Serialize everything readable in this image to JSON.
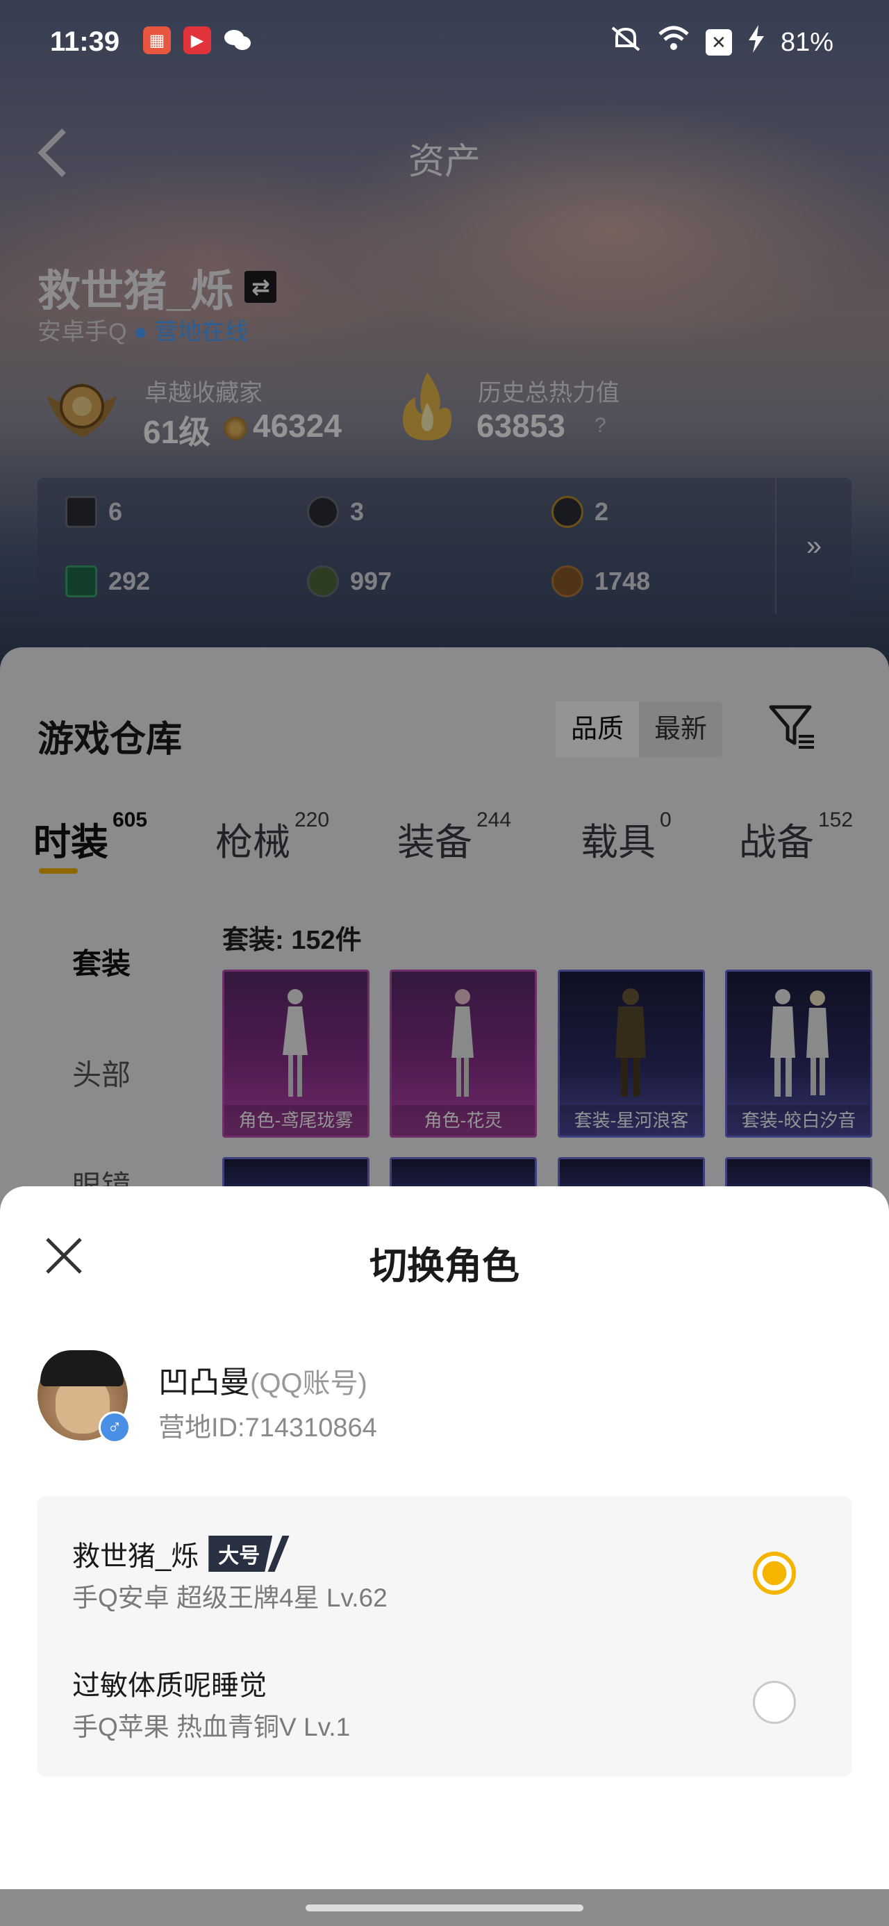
{
  "status_bar": {
    "time": "11:39",
    "battery": "81%",
    "icons": [
      "app-icon-1",
      "video-app-icon",
      "wechat-icon",
      "mute-icon",
      "wifi-icon",
      "x-box-icon",
      "charging-icon"
    ]
  },
  "header": {
    "title": "资产",
    "back_icon": "chevron-left-icon"
  },
  "profile": {
    "name": "救世猪_烁",
    "platform": "安卓手Q",
    "status": "营地在线",
    "rank_title": "卓越收藏家",
    "rank_level": "61级",
    "rank_points": "46324",
    "heat_title": "历史总热力值",
    "heat_value": "63853",
    "heat_help": "?"
  },
  "resources": {
    "items": [
      {
        "icon": "card-icon",
        "value": "6"
      },
      {
        "icon": "coin-silver-icon",
        "value": "3"
      },
      {
        "icon": "coin-gold-icon",
        "value": "2"
      },
      {
        "icon": "ticket-icon",
        "value": "292"
      },
      {
        "icon": "orb-icon",
        "value": "997"
      },
      {
        "icon": "bronze-coin-icon",
        "value": "1748"
      }
    ],
    "more": "»"
  },
  "warehouse": {
    "title": "游戏仓库",
    "sort_options": [
      "品质",
      "最新"
    ],
    "sort_selected": "品质",
    "tabs": [
      {
        "label": "时装",
        "count": "605"
      },
      {
        "label": "枪械",
        "count": "220"
      },
      {
        "label": "装备",
        "count": "244"
      },
      {
        "label": "载具",
        "count": "0"
      },
      {
        "label": "战备",
        "count": "152"
      }
    ],
    "side_nav": [
      "套装",
      "头部",
      "眼镜"
    ],
    "count_title": "套装: 152件",
    "items": [
      {
        "label": "角色-鸢尾珑雾",
        "rarity_color": "#c04fb6"
      },
      {
        "label": "角色-花灵",
        "rarity_color": "#c04fb6"
      },
      {
        "label": "套装-星河浪客",
        "rarity_color": "#6b6fd8"
      },
      {
        "label": "套装-皎白汐音",
        "rarity_color": "#6b6fd8"
      }
    ]
  },
  "sheet": {
    "title": "切换角色",
    "account_name": "凹凸曼",
    "account_type": "(QQ账号)",
    "account_id": "营地ID:714310864",
    "gender": "♂",
    "roles": [
      {
        "name": "救世猪_烁",
        "tag": "大号",
        "detail": "手Q安卓  超级王牌4星  Lv.62",
        "selected": true
      },
      {
        "name": "过敏体质呢睡觉",
        "tag": "",
        "detail": "手Q苹果  热血青铜V  Lv.1",
        "selected": false
      }
    ]
  },
  "colors": {
    "accent": "#f5b400",
    "online": "#4aa3ff",
    "epic": "#c04fb6",
    "rare": "#6b6fd8"
  }
}
